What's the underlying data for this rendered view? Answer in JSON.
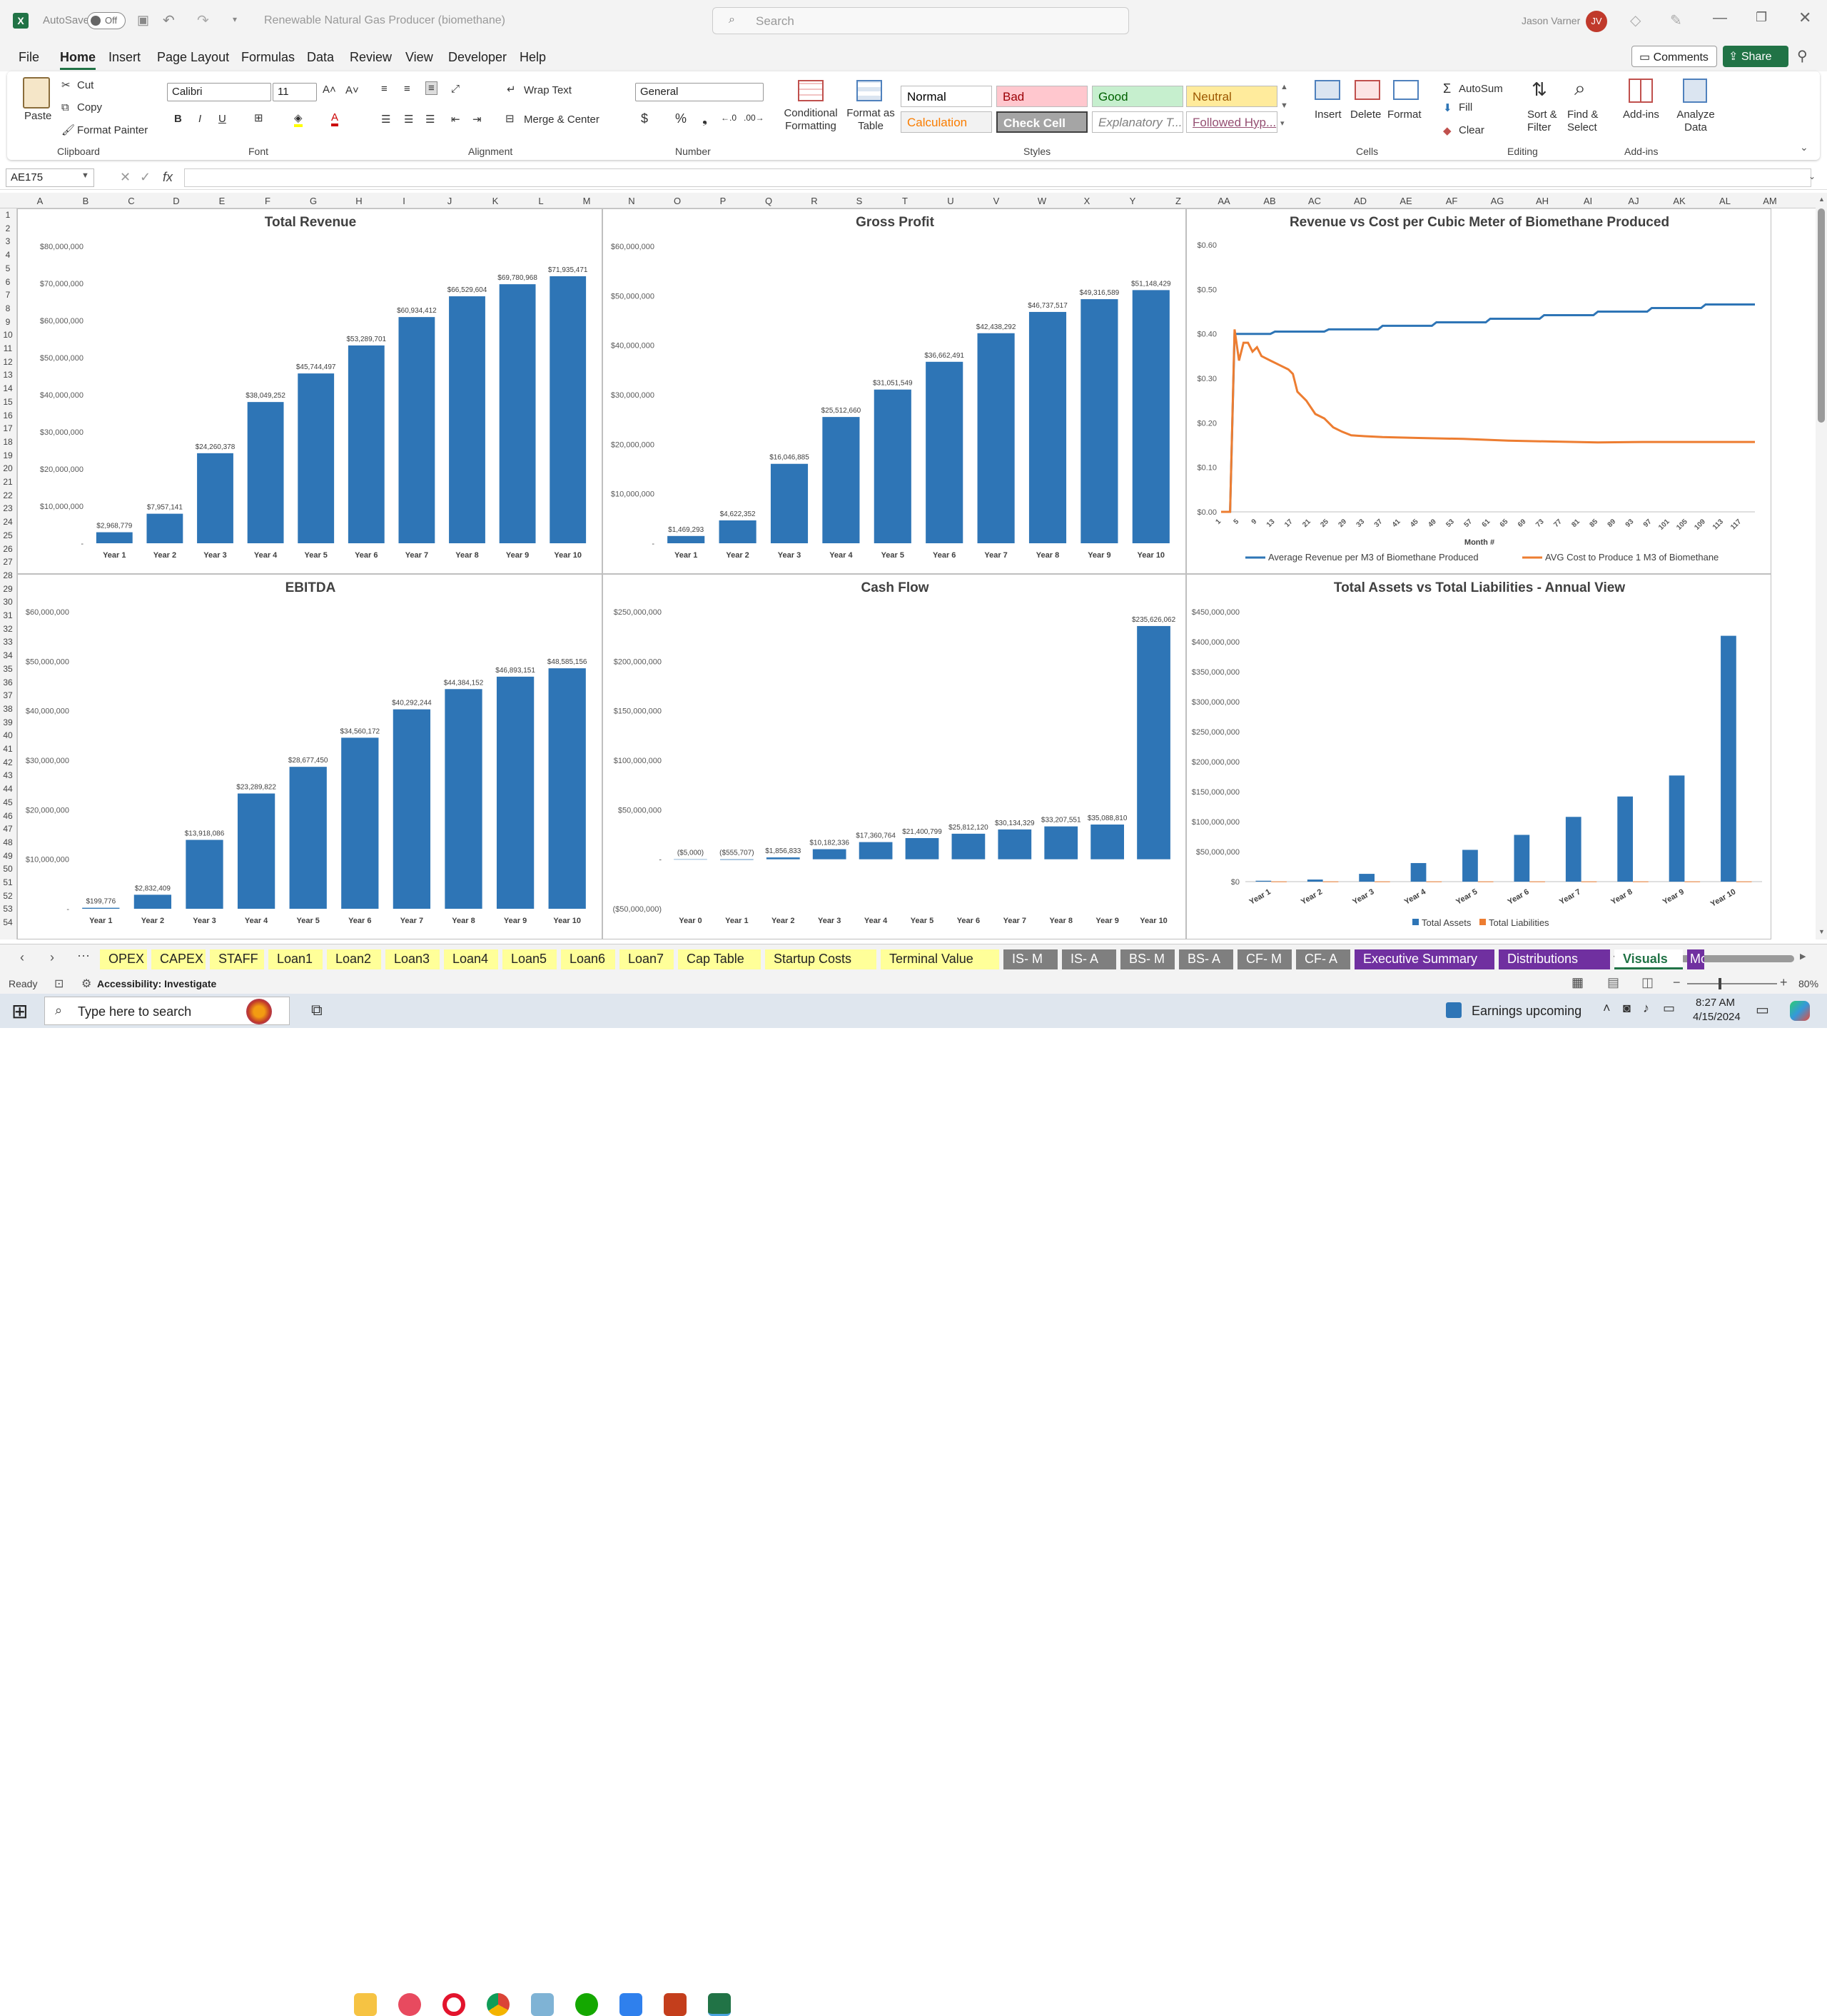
{
  "titlebar": {
    "autosave_label": "AutoSave",
    "autosave_state": "Off",
    "document_title": "Renewable Natural Gas Producer (biomethane)",
    "search_placeholder": "Search",
    "user_name": "Jason Varner",
    "user_initials": "JV"
  },
  "menu": {
    "items": [
      "File",
      "Home",
      "Insert",
      "Page Layout",
      "Formulas",
      "Data",
      "Review",
      "View",
      "Developer",
      "Help"
    ],
    "comments": "Comments",
    "share": "Share"
  },
  "ribbon": {
    "clipboard": {
      "paste": "Paste",
      "cut": "Cut",
      "copy": "Copy",
      "format_painter": "Format Painter",
      "group": "Clipboard"
    },
    "font": {
      "name": "Calibri",
      "size": "11",
      "group": "Font"
    },
    "alignment": {
      "wrap": "Wrap Text",
      "merge": "Merge & Center",
      "group": "Alignment"
    },
    "number": {
      "format": "General",
      "group": "Number"
    },
    "styles": {
      "conditional": "Conditional Formatting",
      "format_table": "Format as Table",
      "group": "Styles",
      "cells": [
        {
          "label": "Normal",
          "bg": "#ffffff",
          "fg": "#000000"
        },
        {
          "label": "Bad",
          "bg": "#ffc7ce",
          "fg": "#9c0006"
        },
        {
          "label": "Good",
          "bg": "#c6efce",
          "fg": "#006100"
        },
        {
          "label": "Neutral",
          "bg": "#ffeb9c",
          "fg": "#9c5700"
        },
        {
          "label": "Calculation",
          "bg": "#f2f2f2",
          "fg": "#fa7d00"
        },
        {
          "label": "Check Cell",
          "bg": "#a5a5a5",
          "fg": "#ffffff"
        },
        {
          "label": "Explanatory T...",
          "bg": "#ffffff",
          "fg": "#7f7f7f"
        },
        {
          "label": "Followed Hyp...",
          "bg": "#ffffff",
          "fg": "#954f72"
        }
      ]
    },
    "cells": {
      "insert": "Insert",
      "delete": "Delete",
      "format": "Format",
      "group": "Cells"
    },
    "editing": {
      "autosum": "AutoSum",
      "fill": "Fill",
      "clear": "Clear",
      "sort": "Sort & Filter",
      "find": "Find & Select",
      "group": "Editing"
    },
    "addins": {
      "addins": "Add-ins",
      "analyze": "Analyze Data",
      "group": "Add-ins"
    }
  },
  "formula_bar": {
    "name_box": "AE175",
    "fx": "fx",
    "value": ""
  },
  "columns": [
    "A",
    "B",
    "C",
    "D",
    "E",
    "F",
    "G",
    "H",
    "I",
    "J",
    "K",
    "L",
    "M",
    "N",
    "O",
    "P",
    "Q",
    "R",
    "S",
    "T",
    "U",
    "V",
    "W",
    "X",
    "Y",
    "Z",
    "AA",
    "AB",
    "AC",
    "AD",
    "AE",
    "AF",
    "AG",
    "AH",
    "AI",
    "AJ",
    "AK",
    "AL",
    "AM"
  ],
  "rows": [
    "1",
    "2",
    "3",
    "4",
    "5",
    "6",
    "7",
    "8",
    "9",
    "10",
    "11",
    "12",
    "13",
    "14",
    "15",
    "16",
    "17",
    "18",
    "19",
    "20",
    "21",
    "22",
    "23",
    "24",
    "25",
    "26",
    "27",
    "28",
    "29",
    "30",
    "31",
    "32",
    "33",
    "34",
    "35",
    "36",
    "37",
    "38",
    "39",
    "40",
    "41",
    "42",
    "43",
    "44",
    "45",
    "46",
    "47",
    "48",
    "49",
    "50",
    "51",
    "52",
    "53",
    "54"
  ],
  "colors": {
    "bar": "#2e75b6",
    "orange": "#ed7d31",
    "excel_green": "#217346",
    "purple_tab": "#7030a0",
    "yellow_tab": "#ffff99",
    "gray_tab": "#7f7f7f"
  },
  "chart_data": [
    {
      "type": "bar",
      "title": "Total Revenue",
      "categories": [
        "Year 1",
        "Year 2",
        "Year 3",
        "Year 4",
        "Year 5",
        "Year 6",
        "Year 7",
        "Year 8",
        "Year 9",
        "Year 10"
      ],
      "values": [
        2968779,
        7957141,
        24260378,
        38049252,
        45744497,
        53289701,
        60934412,
        66529604,
        69780968,
        71935471
      ],
      "data_labels": [
        "$2,968,779",
        "$7,957,141",
        "$24,260,378",
        "$38,049,252",
        "$45,744,497",
        "$53,289,701",
        "$60,934,412",
        "$66,529,604",
        "$69,780,968",
        "$71,935,471"
      ],
      "ylim": [
        0,
        80000000
      ],
      "yticks": [
        "-",
        "$10,000,000",
        "$20,000,000",
        "$30,000,000",
        "$40,000,000",
        "$50,000,000",
        "$60,000,000",
        "$70,000,000",
        "$80,000,000"
      ]
    },
    {
      "type": "bar",
      "title": "Gross Profit",
      "categories": [
        "Year 1",
        "Year 2",
        "Year 3",
        "Year 4",
        "Year 5",
        "Year 6",
        "Year 7",
        "Year 8",
        "Year 9",
        "Year 10"
      ],
      "values": [
        1469293,
        4622352,
        16046885,
        25512660,
        31051549,
        36662491,
        42438292,
        46737517,
        49316589,
        51148429
      ],
      "data_labels": [
        "$1,469,293",
        "$4,622,352",
        "$16,046,885",
        "$25,512,660",
        "$31,051,549",
        "$36,662,491",
        "$42,438,292",
        "$46,737,517",
        "$49,316,589",
        "$51,148,429"
      ],
      "ylim": [
        0,
        60000000
      ],
      "yticks": [
        "-",
        "$10,000,000",
        "$20,000,000",
        "$30,000,000",
        "$40,000,000",
        "$50,000,000",
        "$60,000,000"
      ]
    },
    {
      "type": "line",
      "title": "Revenue vs Cost per Cubic Meter of Biomethane Produced",
      "xlabel": "Month #",
      "xticks": [
        "1",
        "5",
        "9",
        "13",
        "17",
        "21",
        "25",
        "29",
        "33",
        "37",
        "41",
        "45",
        "49",
        "53",
        "57",
        "61",
        "65",
        "69",
        "73",
        "77",
        "81",
        "85",
        "89",
        "93",
        "97",
        "101",
        "105",
        "109",
        "113",
        "117"
      ],
      "ylim": [
        0,
        0.6
      ],
      "yticks": [
        "$0.00",
        "$0.10",
        "$0.20",
        "$0.30",
        "$0.40",
        "$0.50",
        "$0.60"
      ],
      "legend_position": "bottom",
      "series": [
        {
          "name": "Average Revenue per M3 of Biomethane Produced",
          "points": [
            [
              1,
              0
            ],
            [
              3,
              0
            ],
            [
              4,
              0.4
            ],
            [
              12,
              0.4
            ],
            [
              13,
              0.405
            ],
            [
              24,
              0.405
            ],
            [
              25,
              0.41
            ],
            [
              36,
              0.41
            ],
            [
              37,
              0.418
            ],
            [
              48,
              0.418
            ],
            [
              49,
              0.426
            ],
            [
              60,
              0.426
            ],
            [
              61,
              0.434
            ],
            [
              72,
              0.434
            ],
            [
              73,
              0.442
            ],
            [
              84,
              0.442
            ],
            [
              85,
              0.45
            ],
            [
              96,
              0.45
            ],
            [
              97,
              0.458
            ],
            [
              108,
              0.458
            ],
            [
              109,
              0.466
            ],
            [
              120,
              0.466
            ]
          ]
        },
        {
          "name": "AVG Cost to Produce 1 M3 of Biomethane",
          "points": [
            [
              1,
              0
            ],
            [
              3,
              0
            ],
            [
              4,
              0.41
            ],
            [
              5,
              0.34
            ],
            [
              6,
              0.38
            ],
            [
              7,
              0.38
            ],
            [
              8,
              0.36
            ],
            [
              9,
              0.37
            ],
            [
              10,
              0.35
            ],
            [
              12,
              0.34
            ],
            [
              14,
              0.33
            ],
            [
              16,
              0.32
            ],
            [
              17,
              0.31
            ],
            [
              18,
              0.27
            ],
            [
              20,
              0.25
            ],
            [
              22,
              0.22
            ],
            [
              24,
              0.21
            ],
            [
              26,
              0.19
            ],
            [
              28,
              0.18
            ],
            [
              30,
              0.172
            ],
            [
              33,
              0.17
            ],
            [
              37,
              0.168
            ],
            [
              45,
              0.166
            ],
            [
              55,
              0.164
            ],
            [
              65,
              0.16
            ],
            [
              75,
              0.158
            ],
            [
              85,
              0.156
            ],
            [
              95,
              0.157
            ],
            [
              105,
              0.157
            ],
            [
              120,
              0.157
            ]
          ]
        }
      ]
    },
    {
      "type": "bar",
      "title": "EBITDA",
      "categories": [
        "Year 1",
        "Year 2",
        "Year 3",
        "Year 4",
        "Year 5",
        "Year 6",
        "Year 7",
        "Year 8",
        "Year 9",
        "Year 10"
      ],
      "values": [
        199776,
        2832409,
        13918086,
        23289822,
        28677450,
        34560172,
        40292244,
        44384152,
        46893151,
        48585156
      ],
      "data_labels": [
        "$199,776",
        "$2,832,409",
        "$13,918,086",
        "$23,289,822",
        "$28,677,450",
        "$34,560,172",
        "$40,292,244",
        "$44,384,152",
        "$46,893,151",
        "$48,585,156"
      ],
      "ylim": [
        0,
        60000000
      ],
      "yticks": [
        "-",
        "$10,000,000",
        "$20,000,000",
        "$30,000,000",
        "$40,000,000",
        "$50,000,000",
        "$60,000,000"
      ]
    },
    {
      "type": "bar",
      "title": "Cash Flow",
      "categories": [
        "Year 0",
        "Year 1",
        "Year 2",
        "Year 3",
        "Year 4",
        "Year 5",
        "Year 6",
        "Year 7",
        "Year 8",
        "Year 9",
        "Year 10"
      ],
      "values": [
        -5000,
        -555707,
        1856833,
        10182336,
        17360764,
        21400799,
        25812120,
        30134329,
        33207551,
        35088810,
        235626062
      ],
      "data_labels": [
        "($5,000)",
        "($555,707)",
        "$1,856,833",
        "$10,182,336",
        "$17,360,764",
        "$21,400,799",
        "$25,812,120",
        "$30,134,329",
        "$33,207,551",
        "$35,088,810",
        "$235,626,062"
      ],
      "ylim": [
        -50000000,
        250000000
      ],
      "yticks": [
        "($50,000,000)",
        "-",
        "$50,000,000",
        "$100,000,000",
        "$150,000,000",
        "$200,000,000",
        "$250,000,000"
      ]
    },
    {
      "type": "bar",
      "title": "Total Assets vs Total Liabilities - Annual View",
      "categories": [
        "Year 1",
        "Year 2",
        "Year 3",
        "Year 4",
        "Year 5",
        "Year 6",
        "Year 7",
        "Year 8",
        "Year 9",
        "Year 10"
      ],
      "ylim": [
        0,
        450000000
      ],
      "yticks": [
        "$0",
        "$50,000,000",
        "$100,000,000",
        "$150,000,000",
        "$200,000,000",
        "$250,000,000",
        "$300,000,000",
        "$350,000,000",
        "$400,000,000",
        "$450,000,000"
      ],
      "legend_position": "bottom",
      "series": [
        {
          "name": "Total Assets",
          "values": [
            1500000,
            3500000,
            13000000,
            31000000,
            53000000,
            78000000,
            108000000,
            142000000,
            177000000,
            410000000
          ]
        },
        {
          "name": "Total Liabilities",
          "values": [
            400000,
            400000,
            400000,
            400000,
            400000,
            400000,
            400000,
            400000,
            400000,
            400000
          ]
        }
      ]
    }
  ],
  "sheet_tabs": [
    {
      "label": "OPEX",
      "style": "yellow"
    },
    {
      "label": "CAPEX",
      "style": "yellow"
    },
    {
      "label": "STAFF",
      "style": "yellow"
    },
    {
      "label": "Loan1",
      "style": "yellow"
    },
    {
      "label": "Loan2",
      "style": "yellow"
    },
    {
      "label": "Loan3",
      "style": "yellow"
    },
    {
      "label": "Loan4",
      "style": "yellow"
    },
    {
      "label": "Loan5",
      "style": "yellow"
    },
    {
      "label": "Loan6",
      "style": "yellow"
    },
    {
      "label": "Loan7",
      "style": "yellow"
    },
    {
      "label": "Cap Table",
      "style": "yellow"
    },
    {
      "label": "Startup Costs",
      "style": "yellow"
    },
    {
      "label": "Terminal Value",
      "style": "yellow"
    },
    {
      "label": "IS- M",
      "style": "gray"
    },
    {
      "label": "IS- A",
      "style": "gray"
    },
    {
      "label": "BS- M",
      "style": "gray"
    },
    {
      "label": "BS- A",
      "style": "gray"
    },
    {
      "label": "CF- M",
      "style": "gray"
    },
    {
      "label": "CF- A",
      "style": "gray"
    },
    {
      "label": "Executive Summary",
      "style": "purple"
    },
    {
      "label": "Distributions",
      "style": "purple"
    },
    {
      "label": "Visuals",
      "style": "active"
    },
    {
      "label": "Mc",
      "style": "purple"
    }
  ],
  "status": {
    "ready": "Ready",
    "accessibility": "Accessibility: Investigate",
    "zoom": "80%"
  },
  "taskbar": {
    "search_placeholder": "Type here to search",
    "news": "Earnings upcoming",
    "time": "8:27 AM",
    "date": "4/15/2024"
  }
}
